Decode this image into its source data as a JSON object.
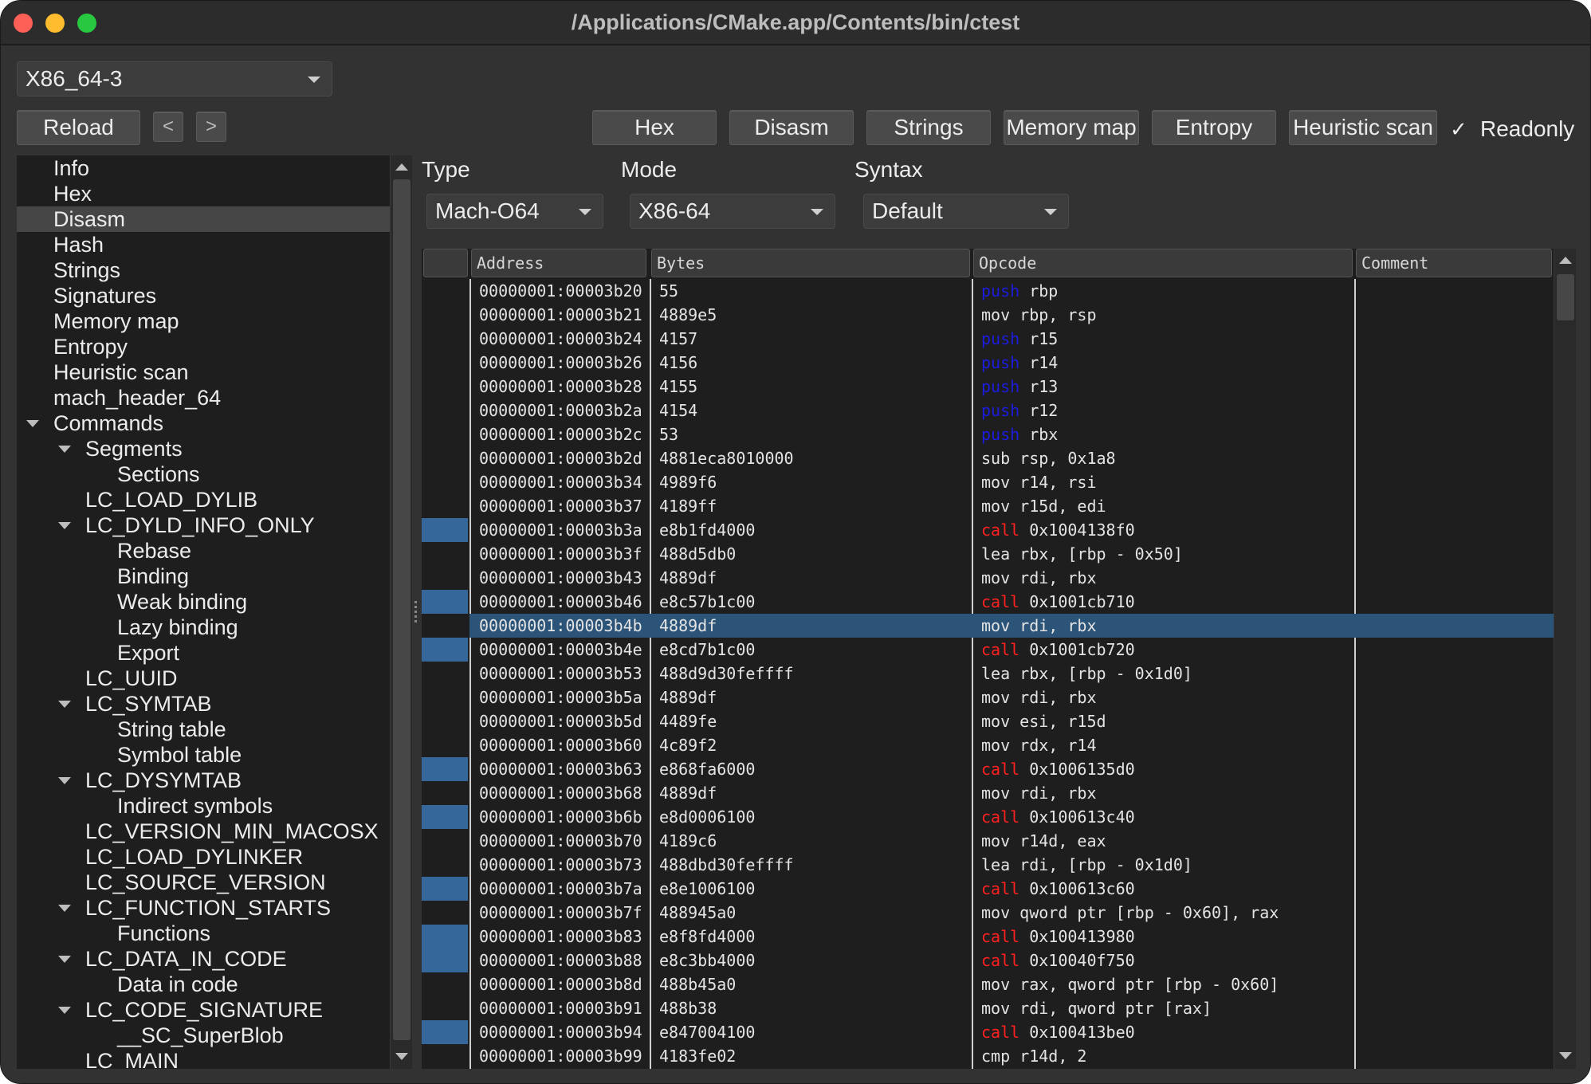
{
  "window": {
    "title": "/Applications/CMake.app/Contents/bin/ctest"
  },
  "toolbar": {
    "arch_select": "X86_64-3",
    "reload": "Reload",
    "back": "<",
    "forward": ">",
    "tabs": [
      "Hex",
      "Disasm",
      "Strings",
      "Memory map",
      "Entropy",
      "Heuristic scan"
    ],
    "readonly_check": "✓",
    "readonly": "Readonly"
  },
  "tree": {
    "items": [
      {
        "label": "Info",
        "level": 0
      },
      {
        "label": "Hex",
        "level": 0
      },
      {
        "label": "Disasm",
        "level": 0,
        "selected": true
      },
      {
        "label": "Hash",
        "level": 0
      },
      {
        "label": "Strings",
        "level": 0
      },
      {
        "label": "Signatures",
        "level": 0
      },
      {
        "label": "Memory map",
        "level": 0
      },
      {
        "label": "Entropy",
        "level": 0
      },
      {
        "label": "Heuristic scan",
        "level": 0
      },
      {
        "label": "mach_header_64",
        "level": 0
      },
      {
        "label": "Commands",
        "level": 0,
        "expanded": true
      },
      {
        "label": "Segments",
        "level": 1,
        "expanded": true
      },
      {
        "label": "Sections",
        "level": 2
      },
      {
        "label": "LC_LOAD_DYLIB",
        "level": 1
      },
      {
        "label": "LC_DYLD_INFO_ONLY",
        "level": 1,
        "expanded": true
      },
      {
        "label": "Rebase",
        "level": 2
      },
      {
        "label": "Binding",
        "level": 2
      },
      {
        "label": "Weak binding",
        "level": 2
      },
      {
        "label": "Lazy binding",
        "level": 2
      },
      {
        "label": "Export",
        "level": 2
      },
      {
        "label": "LC_UUID",
        "level": 1
      },
      {
        "label": "LC_SYMTAB",
        "level": 1,
        "expanded": true
      },
      {
        "label": "String table",
        "level": 2
      },
      {
        "label": "Symbol table",
        "level": 2
      },
      {
        "label": "LC_DYSYMTAB",
        "level": 1,
        "expanded": true
      },
      {
        "label": "Indirect symbols",
        "level": 2
      },
      {
        "label": "LC_VERSION_MIN_MACOSX",
        "level": 1
      },
      {
        "label": "LC_LOAD_DYLINKER",
        "level": 1
      },
      {
        "label": "LC_SOURCE_VERSION",
        "level": 1
      },
      {
        "label": "LC_FUNCTION_STARTS",
        "level": 1,
        "expanded": true
      },
      {
        "label": "Functions",
        "level": 2
      },
      {
        "label": "LC_DATA_IN_CODE",
        "level": 1,
        "expanded": true
      },
      {
        "label": "Data in code",
        "level": 2
      },
      {
        "label": "LC_CODE_SIGNATURE",
        "level": 1,
        "expanded": true
      },
      {
        "label": "__SC_SuperBlob",
        "level": 2
      },
      {
        "label": "LC_MAIN",
        "level": 1
      }
    ]
  },
  "options": {
    "type_label": "Type",
    "type_value": "Mach-O64",
    "mode_label": "Mode",
    "mode_value": "X86-64",
    "syntax_label": "Syntax",
    "syntax_value": "Default"
  },
  "table": {
    "headers": [
      "Address",
      "Bytes",
      "Opcode",
      "Comment"
    ],
    "rows": [
      {
        "addr": "00000001:00003b20",
        "bytes": "55",
        "mn": "push",
        "args": "rbp"
      },
      {
        "addr": "00000001:00003b21",
        "bytes": "4889e5",
        "mn": "mov",
        "args": "rbp, rsp"
      },
      {
        "addr": "00000001:00003b24",
        "bytes": "4157",
        "mn": "push",
        "args": "r15"
      },
      {
        "addr": "00000001:00003b26",
        "bytes": "4156",
        "mn": "push",
        "args": "r14"
      },
      {
        "addr": "00000001:00003b28",
        "bytes": "4155",
        "mn": "push",
        "args": "r13"
      },
      {
        "addr": "00000001:00003b2a",
        "bytes": "4154",
        "mn": "push",
        "args": "r12"
      },
      {
        "addr": "00000001:00003b2c",
        "bytes": "53",
        "mn": "push",
        "args": "rbx"
      },
      {
        "addr": "00000001:00003b2d",
        "bytes": "4881eca8010000",
        "mn": "sub",
        "args": "rsp, 0x1a8"
      },
      {
        "addr": "00000001:00003b34",
        "bytes": "4989f6",
        "mn": "mov",
        "args": "r14, rsi"
      },
      {
        "addr": "00000001:00003b37",
        "bytes": "4189ff",
        "mn": "mov",
        "args": "r15d, edi"
      },
      {
        "addr": "00000001:00003b3a",
        "bytes": "e8b1fd4000",
        "mn": "call",
        "args": "0x1004138f0",
        "mark": true
      },
      {
        "addr": "00000001:00003b3f",
        "bytes": "488d5db0",
        "mn": "lea",
        "args": "rbx, [rbp - 0x50]"
      },
      {
        "addr": "00000001:00003b43",
        "bytes": "4889df",
        "mn": "mov",
        "args": "rdi, rbx"
      },
      {
        "addr": "00000001:00003b46",
        "bytes": "e8c57b1c00",
        "mn": "call",
        "args": "0x1001cb710",
        "mark": true
      },
      {
        "addr": "00000001:00003b4b",
        "bytes": "4889df",
        "mn": "mov",
        "args": "rdi, rbx",
        "selected": true
      },
      {
        "addr": "00000001:00003b4e",
        "bytes": "e8cd7b1c00",
        "mn": "call",
        "args": "0x1001cb720",
        "mark": true
      },
      {
        "addr": "00000001:00003b53",
        "bytes": "488d9d30feffff",
        "mn": "lea",
        "args": "rbx, [rbp - 0x1d0]"
      },
      {
        "addr": "00000001:00003b5a",
        "bytes": "4889df",
        "mn": "mov",
        "args": "rdi, rbx"
      },
      {
        "addr": "00000001:00003b5d",
        "bytes": "4489fe",
        "mn": "mov",
        "args": "esi, r15d"
      },
      {
        "addr": "00000001:00003b60",
        "bytes": "4c89f2",
        "mn": "mov",
        "args": "rdx, r14"
      },
      {
        "addr": "00000001:00003b63",
        "bytes": "e868fa6000",
        "mn": "call",
        "args": "0x1006135d0",
        "mark": true
      },
      {
        "addr": "00000001:00003b68",
        "bytes": "4889df",
        "mn": "mov",
        "args": "rdi, rbx"
      },
      {
        "addr": "00000001:00003b6b",
        "bytes": "e8d0006100",
        "mn": "call",
        "args": "0x100613c40",
        "mark": true
      },
      {
        "addr": "00000001:00003b70",
        "bytes": "4189c6",
        "mn": "mov",
        "args": "r14d, eax"
      },
      {
        "addr": "00000001:00003b73",
        "bytes": "488dbd30feffff",
        "mn": "lea",
        "args": "rdi, [rbp - 0x1d0]"
      },
      {
        "addr": "00000001:00003b7a",
        "bytes": "e8e1006100",
        "mn": "call",
        "args": "0x100613c60",
        "mark": true
      },
      {
        "addr": "00000001:00003b7f",
        "bytes": "488945a0",
        "mn": "mov",
        "args": "qword ptr [rbp - 0x60], rax"
      },
      {
        "addr": "00000001:00003b83",
        "bytes": "e8f8fd4000",
        "mn": "call",
        "args": "0x100413980",
        "mark": true
      },
      {
        "addr": "00000001:00003b88",
        "bytes": "e8c3bb4000",
        "mn": "call",
        "args": "0x10040f750",
        "mark": true
      },
      {
        "addr": "00000001:00003b8d",
        "bytes": "488b45a0",
        "mn": "mov",
        "args": "rax, qword ptr [rbp - 0x60]"
      },
      {
        "addr": "00000001:00003b91",
        "bytes": "488b38",
        "mn": "mov",
        "args": "rdi, qword ptr [rax]"
      },
      {
        "addr": "00000001:00003b94",
        "bytes": "e847004100",
        "mn": "call",
        "args": "0x100413be0",
        "mark": true
      },
      {
        "addr": "00000001:00003b99",
        "bytes": "4183fe02",
        "mn": "cmp",
        "args": "r14d, 2"
      }
    ]
  }
}
